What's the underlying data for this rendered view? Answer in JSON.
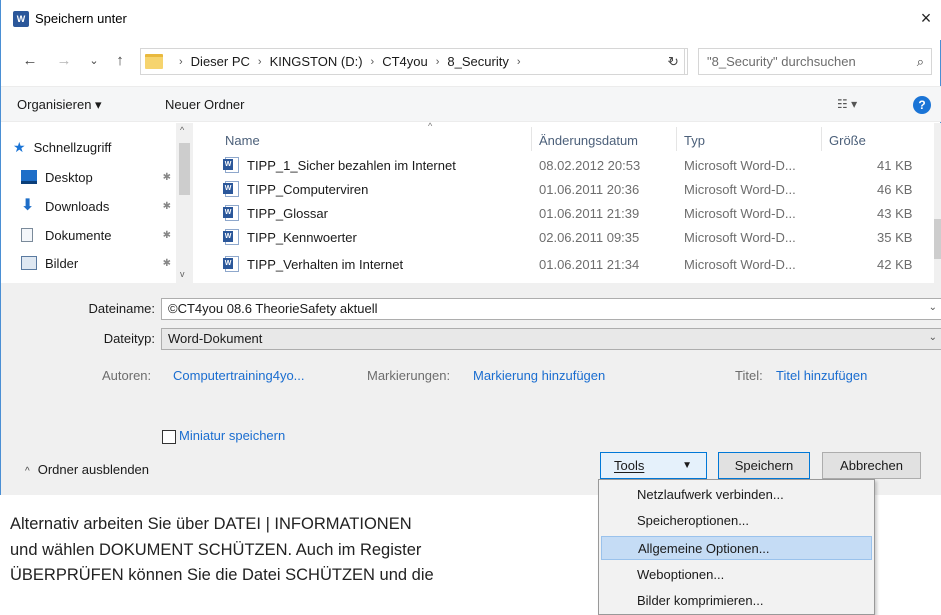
{
  "window": {
    "title": "Speichern unter",
    "close": "×",
    "app_icon": "W"
  },
  "nav": {
    "back": "←",
    "forward": "→",
    "recent": "⌄",
    "up": "↑",
    "breadcrumb": [
      "Dieser PC",
      "KINGSTON (D:)",
      "CT4you",
      "8_Security"
    ],
    "separator": "›",
    "address_dropdown": "⌄",
    "refresh": "↻",
    "search_placeholder": "\"8_Security\" durchsuchen",
    "search_icon": "⌕"
  },
  "toolbar": {
    "organize": "Organisieren ▾",
    "new_folder": "Neuer Ordner",
    "view": "☷ ▾",
    "help": "?"
  },
  "sidebar": {
    "items": [
      {
        "label": "Schnellzugriff",
        "icon": "star-icon"
      },
      {
        "label": "Desktop",
        "icon": "desktop-icon",
        "pin": "✱"
      },
      {
        "label": "Downloads",
        "icon": "download-icon",
        "pin": "✱"
      },
      {
        "label": "Dokumente",
        "icon": "documents-icon",
        "pin": "✱"
      },
      {
        "label": "Bilder",
        "icon": "pictures-icon",
        "pin": "✱"
      }
    ],
    "scroll_up": "^",
    "scroll_down": "v"
  },
  "files": {
    "columns": {
      "name": "Name",
      "date": "Änderungsdatum",
      "type": "Typ",
      "size": "Größe"
    },
    "sort_arrow": "^",
    "rows": [
      {
        "name": "TIPP_1_Sicher bezahlen im Internet",
        "date": "08.02.2012 20:53",
        "type": "Microsoft Word-D...",
        "size": "41 KB"
      },
      {
        "name": "TIPP_Computerviren",
        "date": "01.06.2011 20:36",
        "type": "Microsoft Word-D...",
        "size": "46 KB"
      },
      {
        "name": "TIPP_Glossar",
        "date": "01.06.2011 21:39",
        "type": "Microsoft Word-D...",
        "size": "43 KB"
      },
      {
        "name": "TIPP_Kennwoerter",
        "date": "02.06.2011 09:35",
        "type": "Microsoft Word-D...",
        "size": "35 KB"
      },
      {
        "name": "TIPP_Verhalten im Internet",
        "date": "01.06.2011 21:34",
        "type": "Microsoft Word-D...",
        "size": "42 KB"
      }
    ]
  },
  "form": {
    "filename_label": "Dateiname:",
    "filename_value": "©CT4you 08.6 TheorieSafety aktuell",
    "filetype_label": "Dateityp:",
    "filetype_value": "Word-Dokument",
    "dropdown": "⌄",
    "authors_label": "Autoren:",
    "authors_value": "Computertraining4yo...",
    "tags_label": "Markierungen:",
    "tags_value": "Markierung hinzufügen",
    "title_label": "Titel:",
    "title_value": "Titel hinzufügen",
    "thumbnail_label": "Miniatur speichern",
    "hide_folders": "Ordner ausblenden",
    "hide_chevron": "^"
  },
  "buttons": {
    "tools": "Tools",
    "tools_dd": "▼",
    "save": "Speichern",
    "cancel": "Abbrechen"
  },
  "tools_menu": {
    "items": [
      "Netzlaufwerk verbinden...",
      "Speicheroptionen...",
      "Allgemeine Optionen...",
      "Weboptionen...",
      "Bilder komprimieren..."
    ],
    "highlighted_index": 2
  },
  "body_text": {
    "line1": "Alternativ arbeiten Sie über DATEI | INFORMATIONEN",
    "line2": "und wählen DOKUMENT SCHÜTZEN. Auch im Register",
    "line3": "ÜBERPRÜFEN können Sie die Datei SCHÜTZEN und die"
  },
  "colors": {
    "accent": "#0078d7",
    "link": "#1a6dd0",
    "word_blue": "#2b579a",
    "menu_highlight": "#c5dcf5"
  }
}
